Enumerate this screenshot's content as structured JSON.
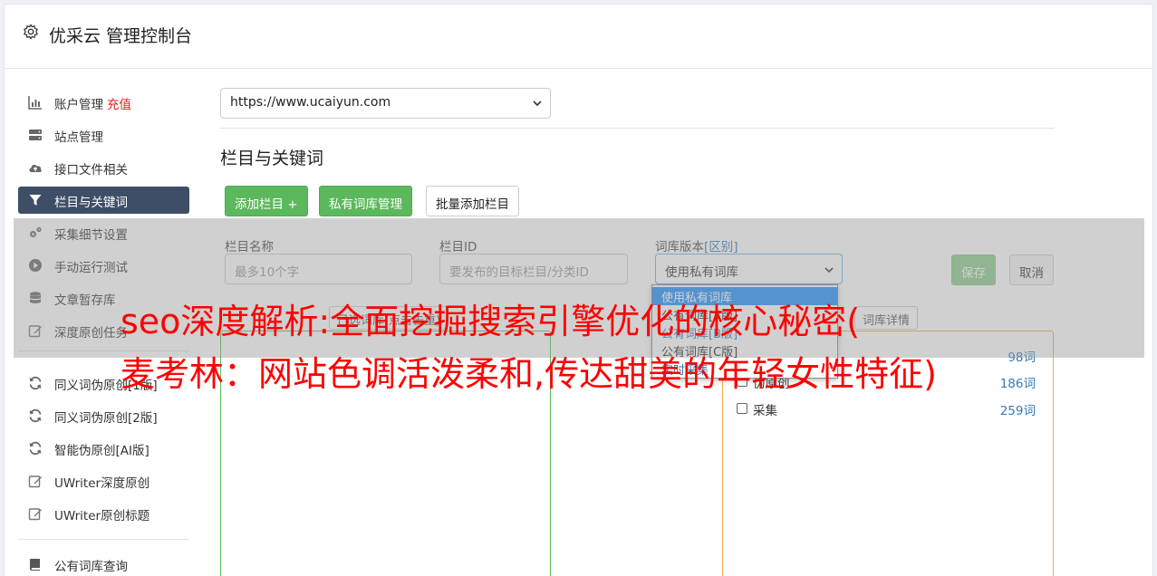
{
  "header": {
    "title": "优采云 管理控制台"
  },
  "sidebar": {
    "items": [
      {
        "label": "账户管理",
        "badge": "充值",
        "icon": "bar-chart-icon"
      },
      {
        "label": "站点管理",
        "icon": "server-icon"
      },
      {
        "label": "接口文件相关",
        "icon": "cloud-upload-icon"
      },
      {
        "label": "栏目与关键词",
        "icon": "filter-icon",
        "active": true
      },
      {
        "label": "采集细节设置",
        "icon": "gears-icon"
      },
      {
        "label": "手动运行测试",
        "icon": "play-circle-icon"
      },
      {
        "label": "文章暂存库",
        "icon": "database-icon"
      },
      {
        "label": "深度原创任务",
        "icon": "edit-icon"
      },
      {
        "label": "同义词伪原创[1版]",
        "icon": "refresh-icon"
      },
      {
        "label": "同义词伪原创[2版]",
        "icon": "refresh-icon"
      },
      {
        "label": "智能伪原创[AI版]",
        "icon": "refresh-icon"
      },
      {
        "label": "UWriter深度原创",
        "icon": "edit-icon"
      },
      {
        "label": "UWriter原创标题",
        "icon": "edit-icon"
      },
      {
        "label": "公有词库查询",
        "icon": "book-icon"
      }
    ]
  },
  "main": {
    "site_select": "https://www.ucaiyun.com",
    "section_title": "栏目与关键词",
    "buttons": {
      "add_column": "添加栏目 +",
      "private_lib": "私有词库管理",
      "batch_add": "批量添加栏目",
      "save": "保存",
      "cancel": "取消"
    },
    "form": {
      "name_label": "栏目名称",
      "name_placeholder": "最多10个字",
      "id_label": "栏目ID",
      "id_placeholder": "要发布的目标栏目/分类ID",
      "version_label": "词库版本",
      "version_link": "[区别]",
      "version_value": "使用私有词库"
    },
    "dropdown": {
      "options": [
        "使用私有词库",
        "公有词库[A版]",
        "公有词库[B版]",
        "公有词库[C版]",
        "实时采集"
      ]
    },
    "left_box": {
      "button": "已选词库(点击去重)"
    },
    "right_box": {
      "button": "词库详情",
      "rows": [
        {
          "name": "",
          "count": "98词"
        },
        {
          "name": "伪原创",
          "count": "186词"
        },
        {
          "name": "采集",
          "count": "259词"
        }
      ]
    }
  },
  "overlay": {
    "line1": "seo深度解析:全面挖掘搜索引擎优化的核心秘密(",
    "line2": "麦考林：网站色调活泼柔和,传达甜美的年轻女性特征)"
  }
}
